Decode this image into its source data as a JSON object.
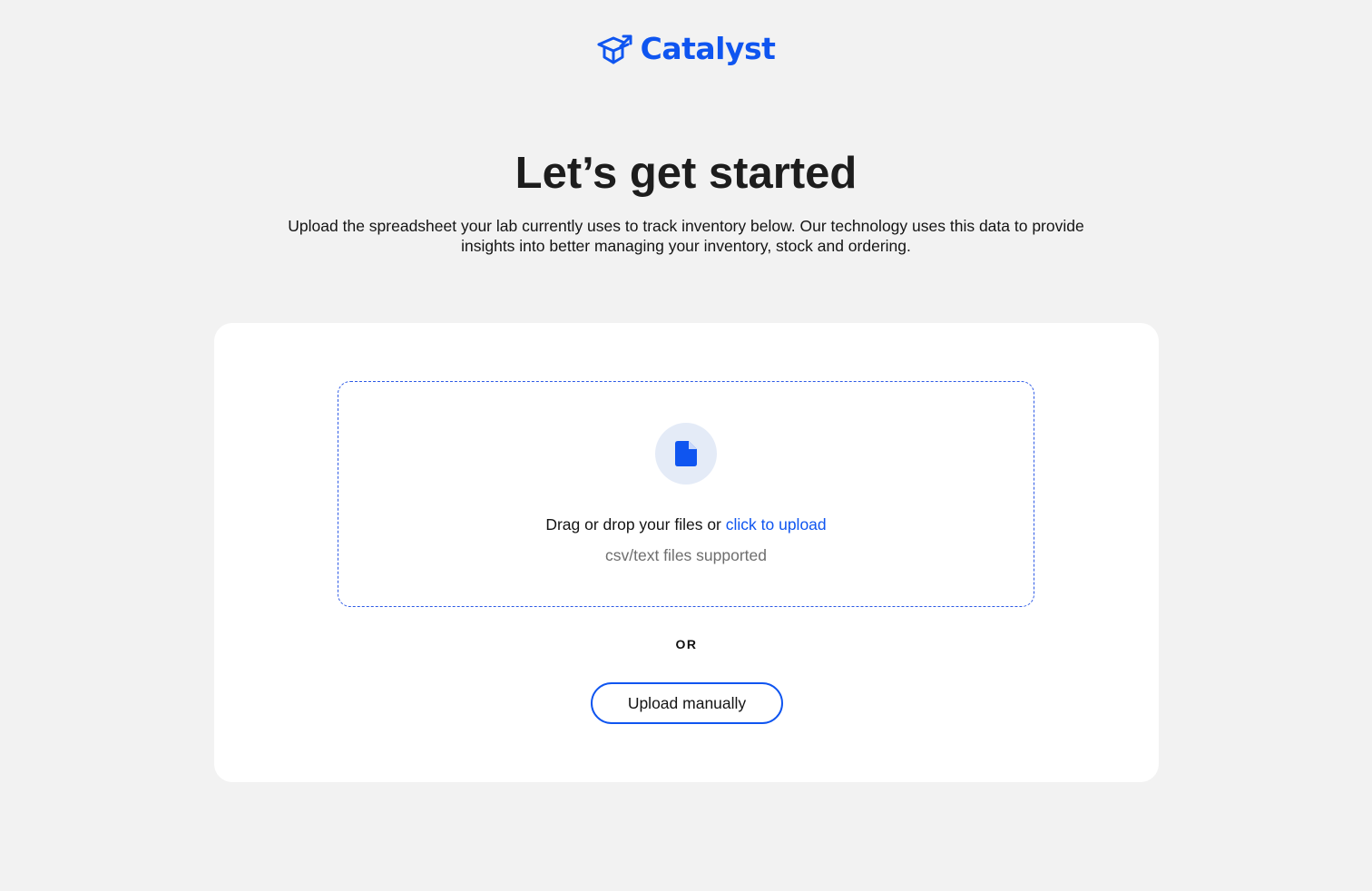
{
  "brand": {
    "name": "Catalyst",
    "logo_icon": "graduation-cap-box-icon",
    "accent_color": "#0f55f0"
  },
  "header": {
    "title": "Let’s get started",
    "description": "Upload the spreadsheet your lab currently uses to track inventory below. Our technology uses this data to provide insights into better managing your inventory, stock and ordering."
  },
  "upload": {
    "icon": "file-icon",
    "prompt_prefix": "Drag or drop your files or ",
    "link_label": "click to upload",
    "hint": "csv/text files supported",
    "divider": "OR",
    "manual_button_label": "Upload manually"
  }
}
